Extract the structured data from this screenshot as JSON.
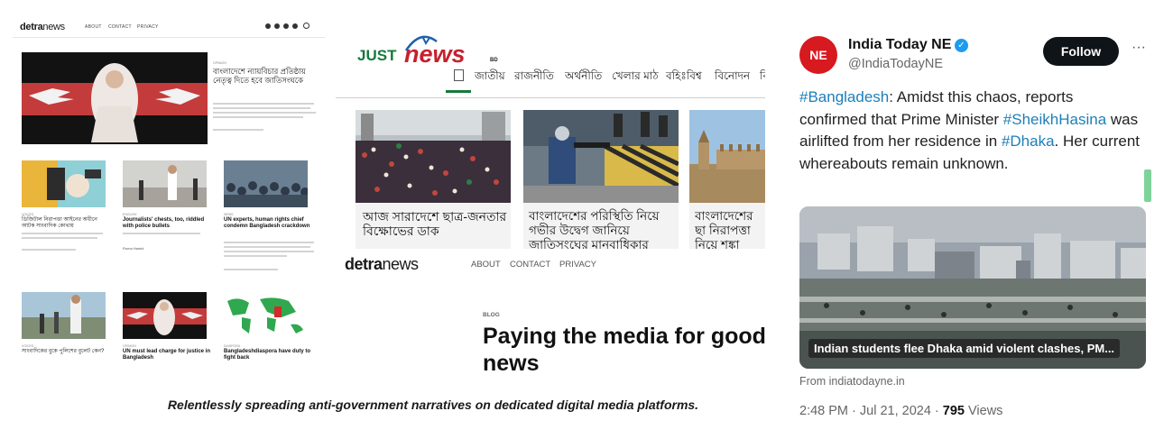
{
  "panel1": {
    "logo": {
      "bold": "detra",
      "light": "news"
    },
    "nav": [
      "ABOUT",
      "CONTACT",
      "PRIVACY"
    ],
    "social_icons": [
      "instagram-icon",
      "twitter-icon",
      "youtube-icon",
      "rss-icon",
      "search-icon"
    ],
    "hero": {
      "headline": "বাংলাদেশে ন্যায়বিচার প্রতিষ্ঠায় নেতৃত্ব দিতে হবে জাতিসংঘকে"
    },
    "cards": [
      {
        "title": "ডিজিটাল নিরাপত্তা আইনের অধীনে আটক সাংবাদিক কোথায়"
      },
      {
        "title": "Journalists' chests, too, riddled with police bullets",
        "author": "Ruma Hamid"
      },
      {
        "title": "UN experts, human rights chief condemn Bangladesh crackdown"
      },
      {
        "title": "সাংবাদিকের বুকে পুলিশের বুলেট কেন?"
      },
      {
        "title": "UN must lead charge for justice in Bangladesh"
      },
      {
        "title": "Bangladeshdiaspora have duty to fight back"
      }
    ]
  },
  "caption": "Relentlessly spreading anti-government narratives on dedicated digital media platforms.",
  "panel2": {
    "just_logo": {
      "a": "JUST",
      "b": "news",
      "suffix": "BD"
    },
    "nav": [
      "জাতীয়",
      "রাজনীতি",
      "অর্থনীতি",
      "খেলার মাঠ",
      "বহিঃবিশ্ব",
      "বিনোদন",
      "বি"
    ],
    "stories": [
      {
        "title": "আজ সারাদেশে ছাত্র-জনতার বিক্ষোভের ডাক"
      },
      {
        "title": "বাংলাদেশের পরিস্থিতি নিয়ে গভীর উদ্বেগ জানিয়ে জাতিসংঘের মানবাধিকার"
      },
      {
        "title": "বাংলাদেশের ছা নিরাপত্তা নিয়ে শঙ্কা প্রকাশ"
      }
    ],
    "detra": {
      "logo": {
        "bold": "detra",
        "light": "news"
      },
      "nav": [
        "ABOUT",
        "CONTACT",
        "PRIVACY"
      ],
      "kicker": "BLOG",
      "headline_l1": "Paying the media for good",
      "headline_l2": "news"
    }
  },
  "panel3": {
    "account_name": "India Today NE",
    "handle": "@IndiaTodayNE",
    "avatar_text": "NE",
    "follow_label": "Follow",
    "more_label": "···",
    "tweet": {
      "p1": "#Bangladesh",
      "p2": ": Amidst this chaos, reports confirmed that Prime Minister ",
      "p3": "#SheikhHasina",
      "p4": " was airlifted from her residence in ",
      "p5": "#Dhaka",
      "p6": ". Her current whereabouts remain unknown."
    },
    "media_caption": "Indian students flee Dhaka amid violent clashes, PM...",
    "source": "From indiatodayne.in",
    "timestamp": "2:48 PM · Jul 21, 2024 · ",
    "views_count": "795",
    "views_label": " Views",
    "colors": {
      "hashtag": "#1d7fb8",
      "follow_bg": "#0f1419",
      "avatar": "#d71920",
      "verified": "#1d9bf0"
    }
  }
}
